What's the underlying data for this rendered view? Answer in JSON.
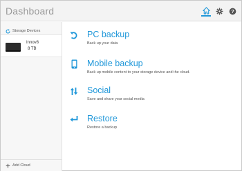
{
  "app": {
    "title": "Dashboard"
  },
  "titlebar_icons": [
    "home-icon",
    "gear-icon",
    "help-icon"
  ],
  "colors": {
    "accent": "#1f97d9",
    "device": "#2b2b2b"
  },
  "sidebar": {
    "header_label": "Storage Devices",
    "device": {
      "name": "Innov8",
      "size": "8 TB"
    },
    "footer_label": "Add Cloud"
  },
  "main": {
    "items": [
      {
        "title": "PC backup",
        "desc": "Back up your data",
        "icon": "backup-arrow-icon"
      },
      {
        "title": "Mobile backup",
        "desc": "Back up mobile content to your storage device and the cloud.",
        "icon": "mobile-phone-icon"
      },
      {
        "title": "Social",
        "desc": "Save and share your social media",
        "icon": "social-arrows-icon"
      },
      {
        "title": "Restore",
        "desc": "Restore a backup",
        "icon": "restore-arrow-icon"
      }
    ]
  }
}
